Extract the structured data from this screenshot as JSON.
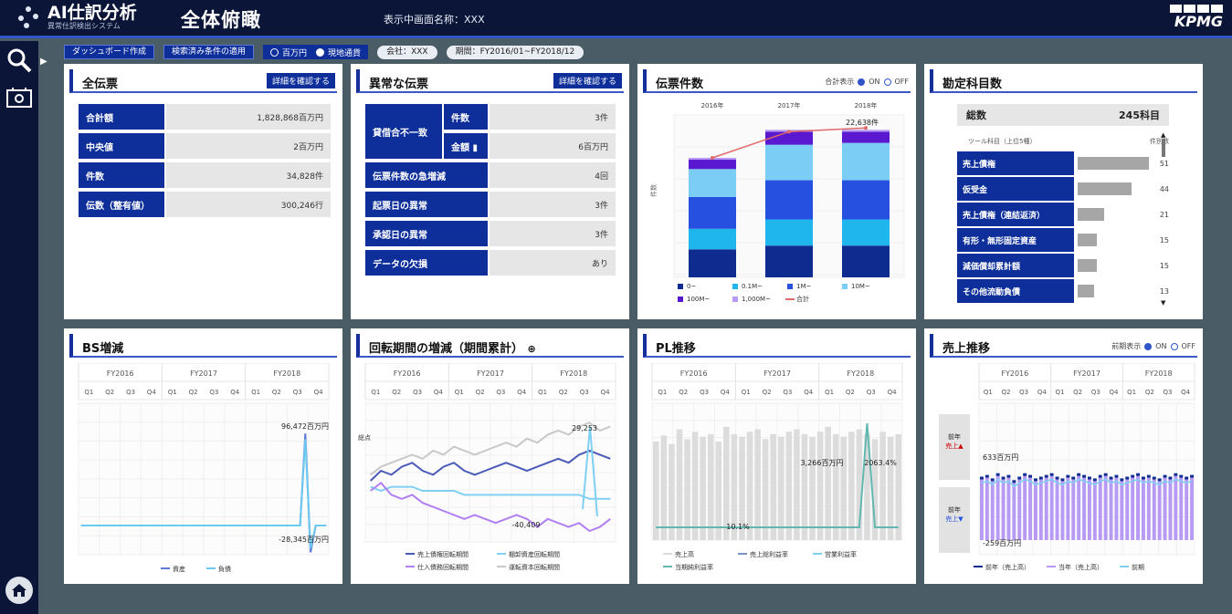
{
  "app": {
    "logo_title": "AI仕訳分析",
    "logo_sub": "異常仕訳検出システム",
    "page_title": "全体俯瞰",
    "company": "表示中画面名称：XXX",
    "brand": "KPMG"
  },
  "controls": {
    "btn1": "ダッシュボード作成",
    "btn2": "検索済み条件の適用",
    "currency_on": "百万円",
    "currency_off": "現地通貨",
    "pill1": "会社：XXX",
    "pill2": "期間：FY2016/01~FY2018/12"
  },
  "panels": {
    "all": {
      "title": "全伝票",
      "detail": "詳細を確認する",
      "rows": [
        {
          "label": "合計額",
          "value": "1,828,868百万円"
        },
        {
          "label": "中央値",
          "value": "2百万円"
        },
        {
          "label": "件数",
          "value": "34,828件"
        },
        {
          "label": "伝数（整有値）",
          "value": "300,246行"
        }
      ]
    },
    "abnormal": {
      "title": "異常な伝票",
      "detail": "詳細を確認する",
      "group_label": "貸借合不一致",
      "sub1": "件数",
      "sub1_value": "3件",
      "sub2": "金額 ▮",
      "sub2_value": "6百万円",
      "rows": [
        {
          "label": "伝票件数の急増減",
          "value": "4回"
        },
        {
          "label": "起票日の異常",
          "value": "3件"
        },
        {
          "label": "承認日の異常",
          "value": "3件"
        },
        {
          "label": "データの欠損",
          "value": "あり"
        }
      ]
    },
    "count": {
      "title": "伝票件数",
      "toggle_label": "合計表示",
      "on": "ON",
      "off": "OFF"
    },
    "accounts": {
      "title": "勘定科目数",
      "total_label": "総数",
      "total_value": "245科目",
      "sub_left": "ツール科目（上位5種）",
      "sub_right": "件別数",
      "items": [
        {
          "label": "売上債権",
          "value": "51",
          "frac": 0.95
        },
        {
          "label": "仮受金",
          "value": "44",
          "frac": 0.72
        },
        {
          "label": "売上債権（連結返済）",
          "value": "21",
          "frac": 0.35
        },
        {
          "label": "有形・無形固定資産",
          "value": "15",
          "frac": 0.25
        },
        {
          "label": "減価償却累計額",
          "value": "15",
          "frac": 0.25
        },
        {
          "label": "その他流動負債",
          "value": "13",
          "frac": 0.22
        }
      ]
    },
    "bs": {
      "title": "BS増減"
    },
    "turnover": {
      "title": "回転期間の増減（期間累計）",
      "info": "⊕"
    },
    "pl": {
      "title": "PL推移"
    },
    "sales": {
      "title": "売上推移",
      "toggle_label": "前期表示",
      "on": "ON",
      "off": "OFF",
      "side_label_top": "前年",
      "side_label_top2": "売上▲",
      "side_label_bot": "前年",
      "side_label_bot2": "売上▼"
    }
  },
  "chart_data": [
    {
      "type": "bar",
      "title": "伝票件数",
      "categories": [
        "2016年",
        "2017年",
        "2018年"
      ],
      "ylabel": "件数",
      "total_label": "22,638件",
      "series": [
        {
          "name": "0~",
          "values": [
            30,
            34,
            34
          ],
          "color": "#0e2b8f"
        },
        {
          "name": "0.1M~",
          "values": [
            22,
            28,
            28
          ],
          "color": "#1fb6ee"
        },
        {
          "name": "1M~",
          "values": [
            34,
            42,
            42
          ],
          "color": "#2550e0"
        },
        {
          "name": "10M~",
          "values": [
            30,
            38,
            40
          ],
          "color": "#7bcdf6"
        },
        {
          "name": "100M~",
          "values": [
            10,
            14,
            12
          ],
          "color": "#5a19d0"
        },
        {
          "name": "1,000M~",
          "values": [
            2,
            2,
            2
          ],
          "color": "#b79af3"
        }
      ],
      "line": {
        "name": "合計",
        "values": [
          128,
          156,
          160
        ],
        "color": "#e06a6a"
      }
    },
    {
      "type": "line",
      "title": "BS増減",
      "years": [
        "FY2016",
        "FY2017",
        "FY2018"
      ],
      "quarters": [
        "Q1",
        "Q2",
        "Q3",
        "Q4",
        "Q1",
        "Q2",
        "Q3",
        "Q4",
        "Q1",
        "Q2",
        "Q3",
        "Q4"
      ],
      "annotation_max": "96,472百万円",
      "annotation_min": "-28,345百万円",
      "series": [
        {
          "name": "資産",
          "color": "#5d7bd6",
          "values": [
            0,
            0,
            0,
            0,
            0,
            0,
            0,
            0,
            0,
            0,
            0,
            0,
            0,
            0,
            0,
            0,
            0,
            0,
            0,
            0,
            0,
            0,
            0,
            0,
            0,
            0,
            0,
            0,
            0,
            0,
            0,
            0,
            0,
            0,
            0,
            0,
            0,
            0,
            0,
            0,
            0,
            0,
            0,
            96,
            -28,
            0,
            0,
            0
          ]
        },
        {
          "name": "負債",
          "color": "#6cc9f0",
          "values": [
            0,
            0,
            0,
            0,
            0,
            0,
            0,
            0,
            0,
            0,
            0,
            0,
            0,
            0,
            0,
            0,
            0,
            0,
            0,
            0,
            0,
            0,
            0,
            0,
            0,
            0,
            0,
            0,
            0,
            0,
            0,
            0,
            0,
            0,
            0,
            0,
            0,
            0,
            0,
            0,
            0,
            0,
            0,
            90,
            -24,
            0,
            0,
            0
          ]
        }
      ]
    },
    {
      "type": "line",
      "title": "回転期間の増減（期間累計）",
      "ylabel": "総点",
      "years": [
        "FY2016",
        "FY2017",
        "FY2018"
      ],
      "quarters": [
        "Q1",
        "Q2",
        "Q3",
        "Q4",
        "Q1",
        "Q2",
        "Q3",
        "Q4",
        "Q1",
        "Q2",
        "Q3",
        "Q4"
      ],
      "annotation_max": "29,253",
      "annotation_min": "-40,409",
      "series": [
        {
          "name": "売上債権回転期間",
          "color": "#4a5ab8",
          "values": [
            5,
            10,
            8,
            12,
            14,
            10,
            8,
            12,
            14,
            10,
            8,
            10,
            12,
            14,
            12,
            10,
            12,
            14,
            16,
            14,
            18,
            20,
            18,
            16
          ]
        },
        {
          "name": "棚卸資産回転期間",
          "color": "#7fd0f3",
          "values": [
            2,
            0,
            2,
            2,
            2,
            0,
            0,
            0,
            0,
            -2,
            -2,
            -2,
            -2,
            -2,
            -2,
            -2,
            -2,
            -2,
            -2,
            -2,
            -2,
            -4,
            -4,
            -4
          ]
        },
        {
          "name": "仕入債務回転期間",
          "color": "#b080f0",
          "values": [
            0,
            4,
            -2,
            -4,
            -2,
            -6,
            -8,
            -10,
            -12,
            -14,
            -12,
            -14,
            -16,
            -14,
            -12,
            -14,
            -18,
            -14,
            -16,
            -18,
            -16,
            -20,
            -18,
            -14
          ]
        },
        {
          "name": "運転資本回転期間",
          "color": "#c8c8c8",
          "values": [
            8,
            12,
            14,
            16,
            18,
            16,
            20,
            18,
            22,
            20,
            18,
            20,
            22,
            24,
            22,
            26,
            24,
            28,
            30,
            28,
            32,
            34,
            30,
            32
          ]
        }
      ]
    },
    {
      "type": "bar",
      "title": "PL推移",
      "years": [
        "FY2016",
        "FY2017",
        "FY2018"
      ],
      "quarters": [
        "Q1",
        "Q2",
        "Q3",
        "Q4",
        "Q1",
        "Q2",
        "Q3",
        "Q4",
        "Q1",
        "Q2",
        "Q3",
        "Q4"
      ],
      "annotation_bar": "3,266百万円",
      "annotation_pct": "2063.4%",
      "annotation_low": "10.1%",
      "series": [
        {
          "name": "売上高",
          "color": "#dcdcdc",
          "values": [
            80,
            85,
            78,
            90,
            82,
            88,
            84,
            86,
            80,
            92,
            86,
            84,
            88,
            90,
            82,
            86,
            84,
            88,
            90,
            86,
            84,
            88,
            92,
            86,
            84,
            88,
            90,
            86,
            82,
            88,
            84,
            86
          ]
        },
        {
          "name": "売上総利益率",
          "color": "#7a8fc8",
          "values": []
        },
        {
          "name": "営業利益率",
          "color": "#7fd0f3",
          "values": []
        },
        {
          "name": "当期純利益率",
          "color": "#62b8b0",
          "values": [
            5,
            5,
            5,
            5,
            5,
            5,
            5,
            5,
            5,
            5,
            5,
            5,
            5,
            5,
            5,
            5,
            5,
            5,
            5,
            5,
            5,
            5,
            5,
            5,
            5,
            5,
            5,
            100,
            5,
            5,
            5,
            5
          ]
        }
      ]
    },
    {
      "type": "bar",
      "title": "売上推移",
      "years": [
        "FY2016",
        "FY2017",
        "FY2018"
      ],
      "quarters": [
        "Q1",
        "Q2",
        "Q3",
        "Q4",
        "Q1",
        "Q2",
        "Q3",
        "Q4",
        "Q1",
        "Q2",
        "Q3",
        "Q4"
      ],
      "annotation_max": "633百万円",
      "annotation_min": "-259百万円",
      "series": [
        {
          "name": "前年（売上高）",
          "color": "#0e2b8f",
          "values": []
        },
        {
          "name": "当年（売上高）",
          "color": "#b79af3",
          "values": [
            70,
            72,
            68,
            74,
            70,
            72,
            66,
            70,
            74,
            72,
            68,
            70,
            72,
            74,
            70,
            68,
            72,
            70,
            74,
            72,
            70,
            68,
            72,
            74,
            70,
            72,
            68,
            70,
            72,
            74,
            70,
            72,
            70,
            68,
            72,
            70,
            74,
            72,
            70,
            72
          ]
        },
        {
          "name": "前期",
          "color": "#7fd0f3",
          "values": []
        }
      ]
    }
  ]
}
